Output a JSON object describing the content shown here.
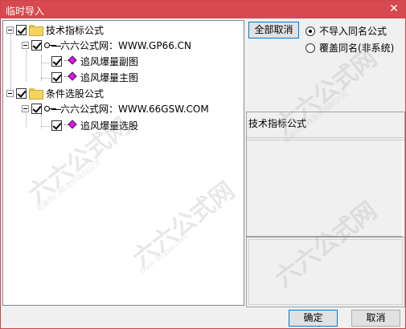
{
  "window": {
    "title": "临时导入",
    "close_glyph": "✕"
  },
  "tree": {
    "group1": {
      "label": "技术指标公式",
      "checked": true
    },
    "group1_source": {
      "label": "六六公式网：WWW.GP66.CN",
      "checked": true
    },
    "group1_items": [
      {
        "label": "追风爆量副图",
        "checked": true
      },
      {
        "label": "追风爆量主图",
        "checked": true
      }
    ],
    "group2": {
      "label": "条件选股公式",
      "checked": true
    },
    "group2_source": {
      "label": "六六公式网：WWW.66GSW.COM",
      "checked": true
    },
    "group2_items": [
      {
        "label": "追风爆量选股",
        "checked": true
      }
    ]
  },
  "options": {
    "deselect_all_label": "全部取消",
    "radio_skip_label": "不导入同名公式",
    "radio_overwrite_label": "覆盖同名(非系统)",
    "selected": "skip"
  },
  "description": {
    "title": "技术指标公式"
  },
  "footer": {
    "ok_label": "确定",
    "cancel_label": "取消"
  },
  "watermark": {
    "brand": "六六公式网",
    "tagline": "紧跟热门精选好指标公式",
    "url": "www.66gsw.com"
  }
}
